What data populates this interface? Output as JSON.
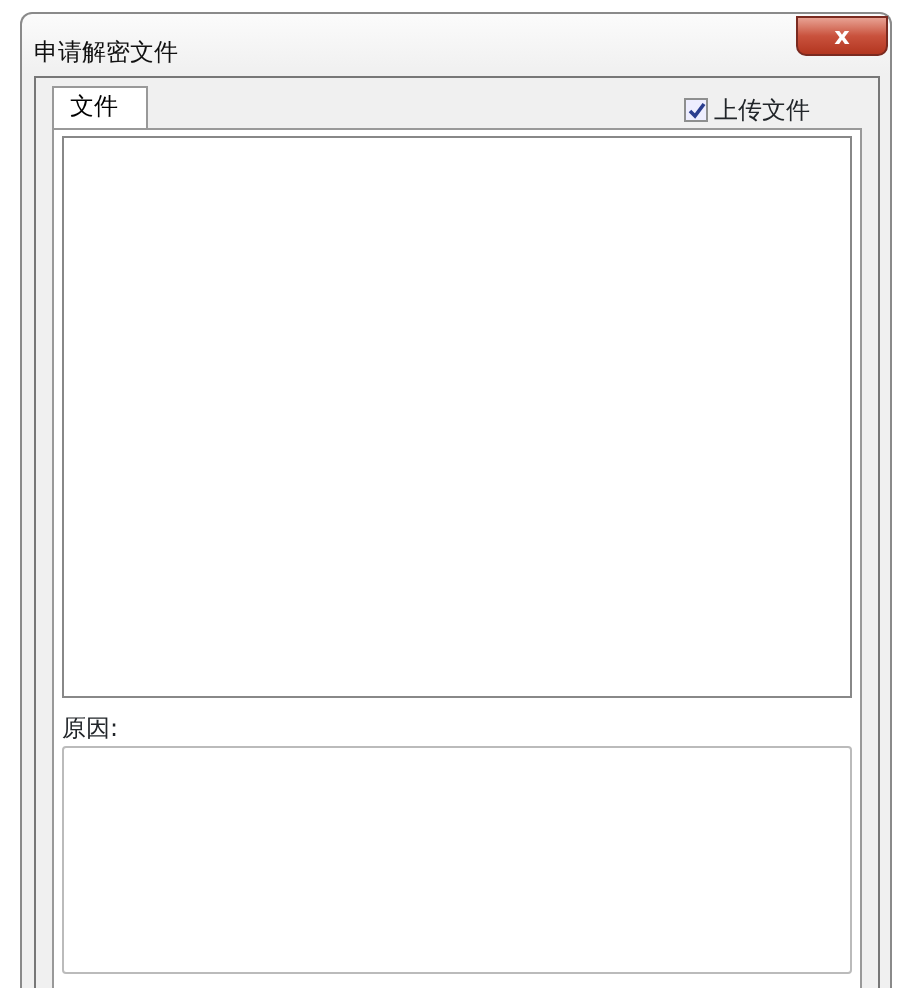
{
  "window": {
    "title": "申请解密文件",
    "close_label": "x"
  },
  "tabs": [
    {
      "label": "文件",
      "selected": true
    }
  ],
  "upload": {
    "label": "上传文件",
    "checked": true
  },
  "reason": {
    "label": "原因:"
  }
}
